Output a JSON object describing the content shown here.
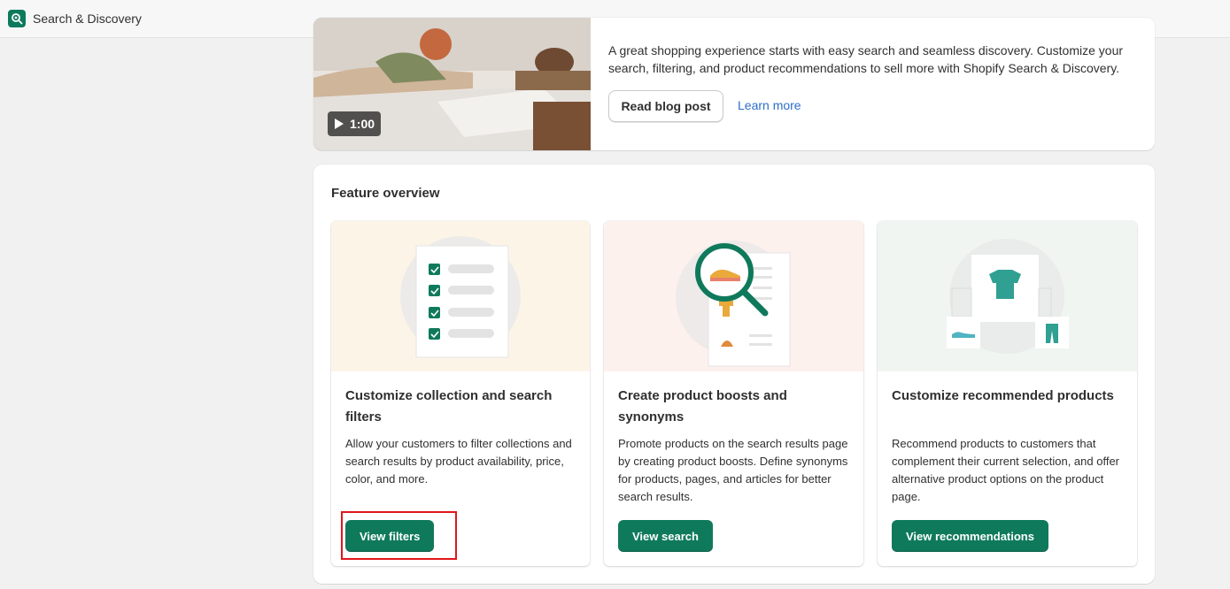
{
  "app": {
    "title": "Search & Discovery",
    "icon": "search-discovery-app-icon"
  },
  "hero": {
    "video_duration": "1:00",
    "description": "A great shopping experience starts with easy search and seamless discovery. Customize your search, filtering, and product recommendations to sell more with Shopify Search & Discovery.",
    "read_blog_label": "Read blog post",
    "learn_more_label": "Learn more"
  },
  "overview": {
    "title": "Feature overview",
    "features": [
      {
        "title": "Customize collection and search filters",
        "description": "Allow your customers to filter collections and search results by product availability, price, color, and more.",
        "button": "View filters",
        "icon": "filter-checklist-icon"
      },
      {
        "title": "Create product boosts and synonyms",
        "description": "Promote products on the search results page by creating product boosts. Define synonyms for products, pages, and articles for better search results.",
        "button": "View search",
        "icon": "magnifier-search-icon"
      },
      {
        "title": "Customize recommended products",
        "description": "Recommend products to customers that complement their current selection, and offer alternative product options on the product page.",
        "button": "View recommendations",
        "icon": "recommendation-tshirt-icon"
      }
    ]
  },
  "colors": {
    "primary": "#0f7a5b",
    "link": "#2c6ecb",
    "highlight": "#e0161b"
  }
}
